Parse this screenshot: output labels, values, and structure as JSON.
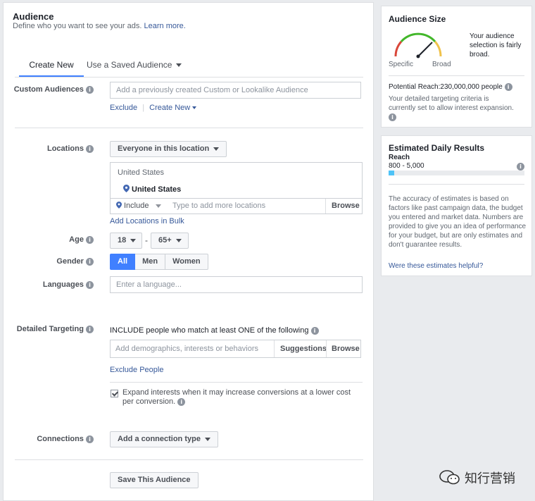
{
  "audience": {
    "title": "Audience",
    "subtitle": "Define who you want to see your ads.",
    "learn_more": "Learn more.",
    "tabs": {
      "create_new": "Create New",
      "saved": "Use a Saved Audience"
    }
  },
  "custom_audiences": {
    "label": "Custom Audiences",
    "placeholder": "Add a previously created Custom or Lookalike Audience",
    "exclude": "Exclude",
    "create_new": "Create New"
  },
  "locations": {
    "label": "Locations",
    "dropdown": "Everyone in this location",
    "country_header": "United States",
    "selected": "United States",
    "include": "Include",
    "placeholder": "Type to add more locations",
    "browse": "Browse",
    "bulk": "Add Locations in Bulk"
  },
  "age": {
    "label": "Age",
    "min": "18",
    "dash": "-",
    "max": "65+"
  },
  "gender": {
    "label": "Gender",
    "all": "All",
    "men": "Men",
    "women": "Women"
  },
  "languages": {
    "label": "Languages",
    "placeholder": "Enter a language..."
  },
  "detailed": {
    "label": "Detailed Targeting",
    "include_text": "INCLUDE people who match at least ONE of the following",
    "placeholder": "Add demographics, interests or behaviors",
    "suggestions": "Suggestions",
    "browse": "Browse",
    "exclude": "Exclude People",
    "expand": "Expand interests when it may increase conversions at a lower cost per conversion."
  },
  "connections": {
    "label": "Connections",
    "button": "Add a connection type"
  },
  "save_button": "Save This Audience",
  "audience_size": {
    "title": "Audience Size",
    "specific": "Specific",
    "broad": "Broad",
    "description": "Your audience selection is fairly broad.",
    "potential_reach": "Potential Reach:230,000,000 people",
    "note": "Your detailed targeting criteria is currently set to allow interest expansion."
  },
  "daily_results": {
    "title": "Estimated Daily Results",
    "reach_label": "Reach",
    "reach_value": "800 - 5,000",
    "reach_fill": 0.04,
    "disclaimer": "The accuracy of estimates is based on factors like past campaign data, the budget you entered and market data. Numbers are provided to give you an idea of performance for your budget, but are only estimates and don't guarantee results.",
    "helpful": "Were these estimates helpful?"
  },
  "watermark": "知行营销",
  "colors": {
    "accent": "#4080ff",
    "link": "#365899",
    "reach_bar": "#4fc3f7"
  }
}
